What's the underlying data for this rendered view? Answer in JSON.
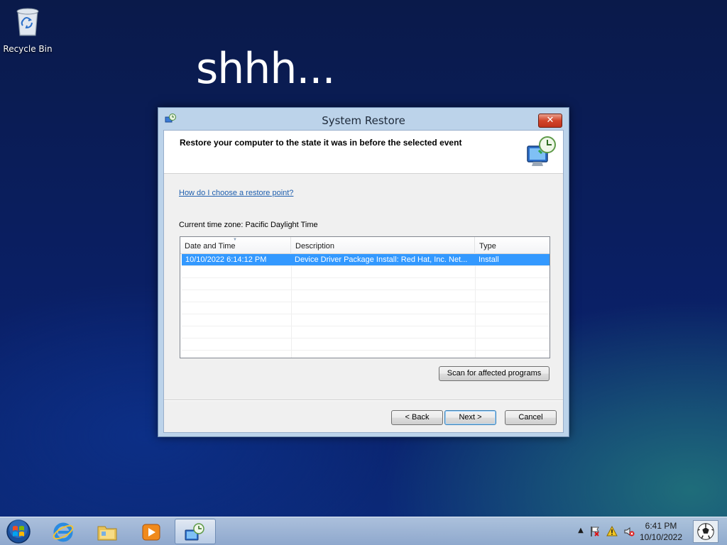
{
  "desktop": {
    "icons": [
      {
        "label": "Recycle Bin",
        "icon": "recycle-bin-icon"
      }
    ],
    "overlay_text": "shhh..."
  },
  "window": {
    "title": "System Restore",
    "close_label": "✕",
    "header": "Restore your computer to the state it was in before the selected event",
    "help_link": "How do I choose a restore point?",
    "timezone_label": "Current time zone: Pacific Daylight Time",
    "table": {
      "columns": [
        "Date and Time",
        "Description",
        "Type"
      ],
      "rows": [
        {
          "date": "10/10/2022 6:14:12 PM",
          "description": "Device Driver Package Install: Red Hat, Inc. Net...",
          "type": "Install",
          "selected": true
        }
      ]
    },
    "scan_button": "Scan for affected programs",
    "back_button": "< Back",
    "next_button": "Next >",
    "cancel_button": "Cancel"
  },
  "taskbar": {
    "pinned": [
      "internet-explorer-icon",
      "windows-explorer-icon",
      "media-player-icon",
      "system-restore-icon"
    ],
    "active_item": "system-restore-icon",
    "tray_icons": [
      "show-hidden-icons-arrow",
      "action-center-flag-icon",
      "warning-icon",
      "volume-muted-icon"
    ],
    "clock": {
      "time": "6:41 PM",
      "date": "10/10/2022"
    }
  },
  "colors": {
    "selection": "#3399ff",
    "link": "#1f5fae",
    "close_button": "#c7432b"
  }
}
